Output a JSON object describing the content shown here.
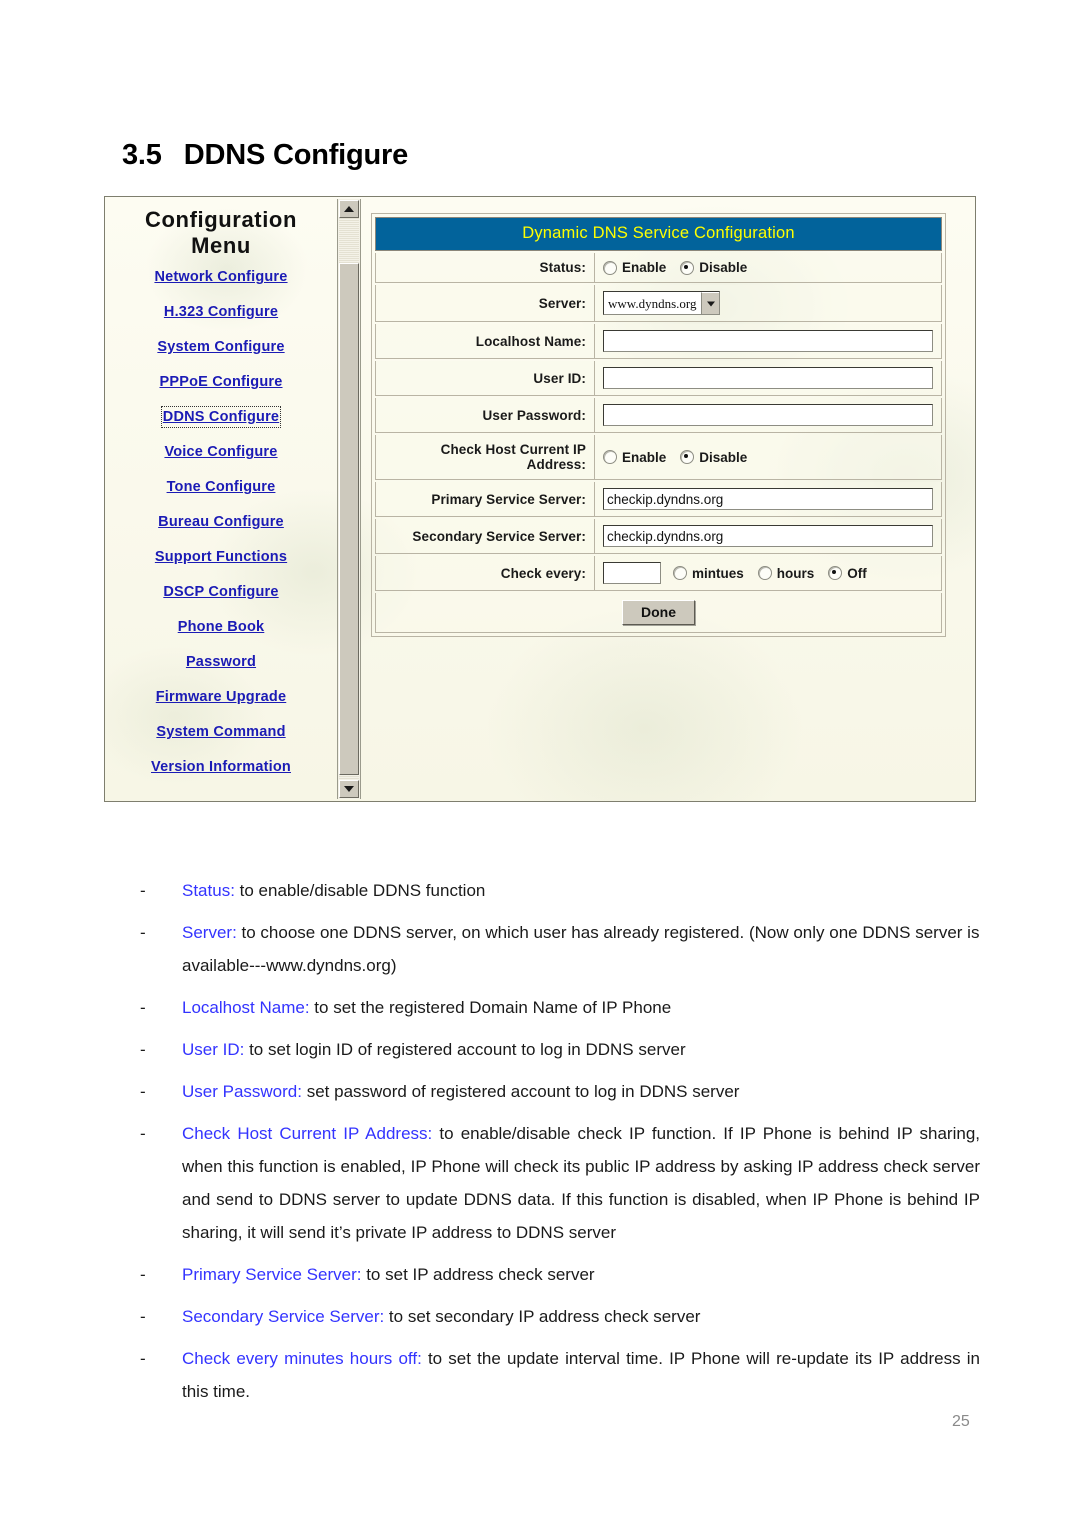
{
  "heading": {
    "number": "3.5",
    "title": "DDNS Configure"
  },
  "screenshot": {
    "menu": {
      "title_line1": "Configuration",
      "title_line2": "Menu",
      "items": [
        {
          "label": "Network Configure",
          "active": false
        },
        {
          "label": "H.323 Configure",
          "active": false
        },
        {
          "label": "System Configure",
          "active": false
        },
        {
          "label": "PPPoE Configure",
          "active": false
        },
        {
          "label": "DDNS Configure",
          "active": true
        },
        {
          "label": "Voice Configure",
          "active": false
        },
        {
          "label": "Tone Configure",
          "active": false
        },
        {
          "label": "Bureau Configure",
          "active": false
        },
        {
          "label": "Support Functions",
          "active": false
        },
        {
          "label": "DSCP Configure",
          "active": false
        },
        {
          "label": "Phone Book",
          "active": false
        },
        {
          "label": "Password",
          "active": false
        },
        {
          "label": "Firmware Upgrade",
          "active": false
        },
        {
          "label": "System Command",
          "active": false
        },
        {
          "label": "Version Information",
          "active": false
        }
      ]
    },
    "scrollbar": {
      "up_arrow": "scroll-up-arrow",
      "down_arrow": "scroll-down-arrow"
    },
    "form": {
      "header": "Dynamic DNS Service Configuration",
      "rows": {
        "status": {
          "label": "Status:",
          "options": [
            "Enable",
            "Disable"
          ],
          "selected": "Disable"
        },
        "server": {
          "label": "Server:",
          "value": "www.dyndns.org",
          "options": [
            "www.dyndns.org"
          ]
        },
        "localhost_name": {
          "label": "Localhost Name:",
          "value": ""
        },
        "user_id": {
          "label": "User ID:",
          "value": ""
        },
        "user_password": {
          "label": "User Password:",
          "value": ""
        },
        "check_host_ip": {
          "label": "Check Host Current IP Address:",
          "options": [
            "Enable",
            "Disable"
          ],
          "selected": "Disable"
        },
        "primary_service_server": {
          "label": "Primary Service Server:",
          "value": "checkip.dyndns.org"
        },
        "secondary_service_server": {
          "label": "Secondary Service Server:",
          "value": "checkip.dyndns.org"
        },
        "check_every": {
          "label": "Check every:",
          "value": "",
          "options": [
            "mintues",
            "hours",
            "Off"
          ],
          "selected": "Off"
        }
      },
      "done_button": "Done"
    },
    "colors": {
      "header_bg": "#02639b",
      "header_text": "#ffff00",
      "link": "#1b1bb5",
      "panel_bg": "#fbfaef"
    }
  },
  "descriptions": [
    {
      "term": "Status:",
      "text": " to enable/disable DDNS function",
      "justify": false
    },
    {
      "term": "Server:",
      "text": " to choose one DDNS server, on which user has already registered. (Now only one DDNS server is available---www.dyndns.org)",
      "justify": false
    },
    {
      "term": "Localhost Name:",
      "text": " to set the registered Domain Name of IP Phone",
      "justify": false
    },
    {
      "term": "User ID:",
      "text": " to set login ID of registered account to log in DDNS server",
      "justify": false
    },
    {
      "term": "User Password:",
      "text": " set password of registered account to log in DDNS server",
      "justify": false
    },
    {
      "term": "Check Host Current IP Address:",
      "text": " to enable/disable check IP function. If IP Phone is behind IP sharing, when this function is enabled, IP Phone will check its public IP address by asking IP address check server and send to DDNS server to update DDNS data. If this function is disabled, when IP Phone is behind IP sharing, it will send it’s private IP address to DDNS server",
      "justify": true
    },
    {
      "term": "Primary Service Server:",
      "text": " to set IP address check server",
      "justify": false
    },
    {
      "term": "Secondary Service Server:",
      "text": " to set secondary IP address check server",
      "justify": false
    },
    {
      "term": "Check every minutes hours off:",
      "text": " to set the update interval time. IP Phone will re-update its IP address in this time.",
      "justify": true
    }
  ],
  "footer": {
    "page_number": "25"
  },
  "bullet_marker": "-"
}
